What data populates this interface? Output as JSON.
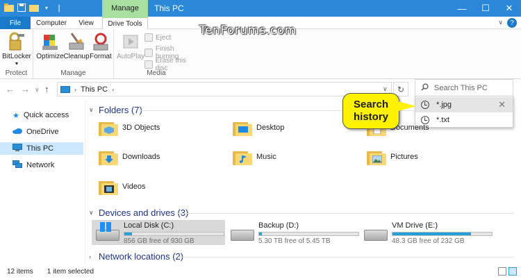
{
  "watermark": "TenForums.com",
  "titlebar": {
    "context_tab": "Manage",
    "title": "This PC",
    "minimize": "—",
    "maximize": "☐",
    "close": "✕"
  },
  "ribbon_tabs": {
    "file": "File",
    "computer": "Computer",
    "view": "View",
    "drive_tools": "Drive Tools",
    "collapse": "∨",
    "help": "?"
  },
  "ribbon": {
    "protect": {
      "label": "Protect",
      "bitlocker": "BitLocker"
    },
    "manage": {
      "label": "Manage",
      "optimize": "Optimize",
      "cleanup": "Cleanup",
      "format": "Format"
    },
    "media": {
      "label": "Media",
      "autoplay": "AutoPlay",
      "eject": "Eject",
      "finish_burning": "Finish burning",
      "erase": "Erase this disc"
    }
  },
  "nav": {
    "back": "←",
    "forward": "→",
    "recent": "∨",
    "up": "↑",
    "location": "This PC",
    "refresh": "↻"
  },
  "search": {
    "placeholder": "Search This PC",
    "history_callout": [
      "Search",
      "history"
    ],
    "history": [
      "*.jpg",
      "*.txt"
    ],
    "remove": "✕"
  },
  "sidebar": {
    "items": [
      "Quick access",
      "OneDrive",
      "This PC",
      "Network"
    ]
  },
  "sections": {
    "folders": "Folders (7)",
    "devices": "Devices and drives (3)",
    "network": "Network locations (2)"
  },
  "folders": [
    "3D Objects",
    "Desktop",
    "Documents",
    "Downloads",
    "Music",
    "Pictures",
    "Videos"
  ],
  "drives": [
    {
      "name": "Local Disk (C:)",
      "free": "856 GB free of 930 GB",
      "used_fraction": 0.08
    },
    {
      "name": "Backup (D:)",
      "free": "5.30 TB free of 5.45 TB",
      "used_fraction": 0.03
    },
    {
      "name": "VM Drive (E:)",
      "free": "48.3 GB free of 232 GB",
      "used_fraction": 0.79
    }
  ],
  "status": {
    "items": "12 items",
    "selected": "1 item selected"
  },
  "colors": {
    "titlebar": "#2b88d8",
    "manage_tab": "#a8e0a0",
    "accent": "#26a0da",
    "callout": "#fff200",
    "section_heading": "#1e3287"
  }
}
